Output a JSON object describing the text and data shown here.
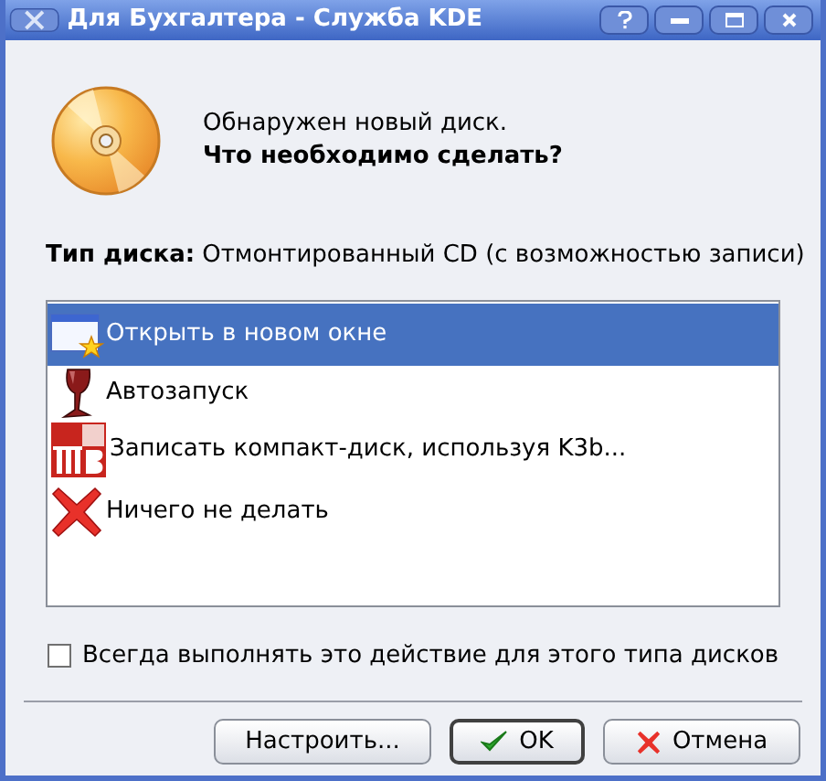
{
  "window": {
    "title": "Для Бухгалтера - Служба KDE"
  },
  "message": {
    "line_1": "Обнаружен новый диск.",
    "line_2": "Что необходимо сделать?"
  },
  "disk_type": {
    "label": "Тип диска:",
    "value": "Отмонтированный CD (с возможностью записи)"
  },
  "actions": [
    {
      "label": "Открыть в новом окне",
      "selected": true
    },
    {
      "label": "Автозапуск",
      "selected": false
    },
    {
      "label": "Записать компакт-диск, используя K3b...",
      "selected": false
    },
    {
      "label": "Ничего не делать",
      "selected": false
    }
  ],
  "always_checkbox": {
    "label": "Всегда выполнять это действие для этого типа дисков",
    "checked": false
  },
  "buttons": [
    {
      "label": "Настроить...",
      "kind": "plain",
      "default": false
    },
    {
      "label": "OK",
      "kind": "ok",
      "default": true
    },
    {
      "label": "Отмена",
      "kind": "cancel",
      "default": false
    }
  ]
}
